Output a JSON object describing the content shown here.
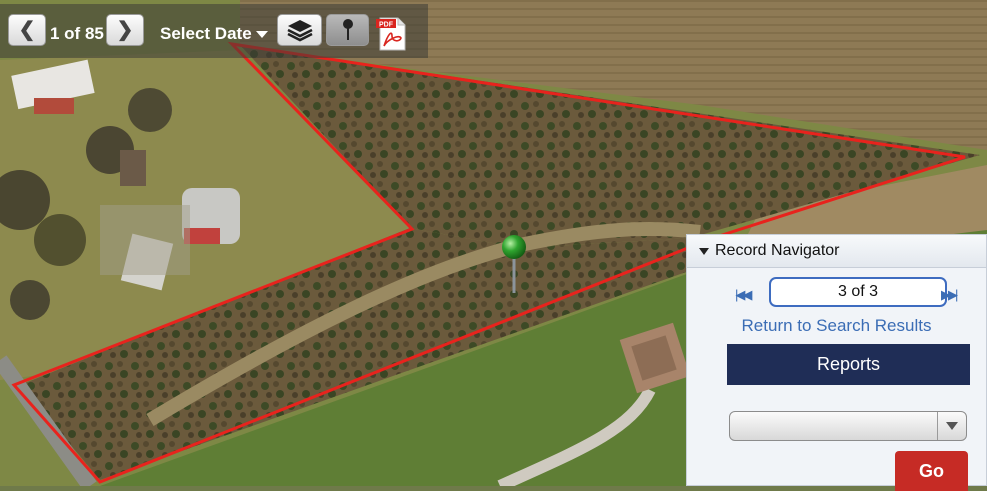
{
  "toolbar": {
    "page_count": "1 of 85",
    "select_date_label": "Select Date",
    "prev_icon": "chevron-left-icon",
    "next_icon": "chevron-right-icon",
    "layers_icon": "layers-icon",
    "pin_icon": "pushpin-icon",
    "pdf_icon": "pdf-icon",
    "pdf_icon_text": "PDF"
  },
  "record_navigator": {
    "title": "Record Navigator",
    "counter": "3 of 3",
    "return_link": "Return to Search Results",
    "reports_label": "Reports",
    "report_select_value": "",
    "go_label": "Go"
  },
  "map": {
    "parcel_outline_color": "#e8231d",
    "marker_color": "#2e9c2e",
    "map_type": "aerial-imagery"
  }
}
